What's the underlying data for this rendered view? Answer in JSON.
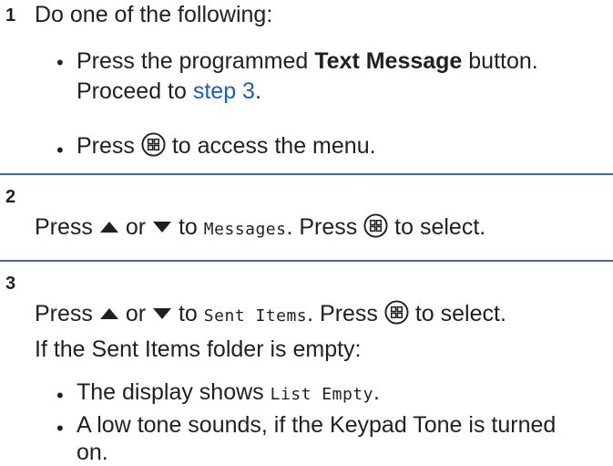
{
  "step1": {
    "num": "1",
    "intro": "Do one of the following:",
    "bullet_a": {
      "pre": "Press the programmed ",
      "bold": "Text Message",
      "post": " button.",
      "line2_pre": "Proceed to ",
      "link": "step 3",
      "line2_post": "."
    },
    "bullet_b": {
      "pre": "Press",
      "post": "to access the menu."
    }
  },
  "step2": {
    "num": "2",
    "press": "Press",
    "or": "or",
    "to": "to",
    "target": "Messages",
    "after": ". Press",
    "end": "to select."
  },
  "step3": {
    "num": "3",
    "press": "Press",
    "or": "or",
    "to": "to",
    "target": "Sent Items",
    "after": ". Press",
    "end": "to select.",
    "condition": "If the Sent Items folder is empty:",
    "bullet_a": {
      "pre": "The display shows ",
      "mono": "List Empty",
      "post": "."
    },
    "bullet_b": {
      "line1": "A low tone sounds, if the Keypad Tone is turned",
      "line2": "on."
    }
  },
  "icons": {
    "menu": "menu-ok-button-icon",
    "up": "up-arrow-icon",
    "down": "down-arrow-icon"
  },
  "colors": {
    "rule": "#3b6fb1",
    "link": "#1a5fc0",
    "text": "#231f20"
  }
}
